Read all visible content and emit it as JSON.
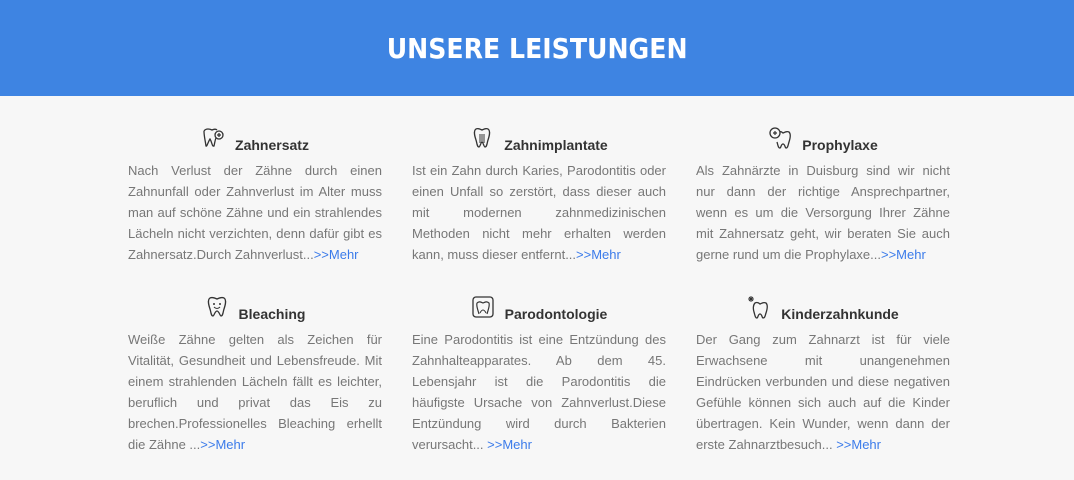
{
  "header": {
    "title": "UNSERE LEISTUNGEN"
  },
  "services": [
    {
      "icon": "tooth-plus-icon",
      "title": "Zahnersatz",
      "lines": [
        "Nach Verlust der Zähne durch einen",
        "Zahnunfall oder Zahnverlust im Alter muss",
        "man auf schöne Zähne und ein strahlendes",
        "Lächeln nicht verzichten, denn dafür gibt es",
        "Zahnersatz.Durch Zahnverlust..."
      ],
      "more": ">>Mehr"
    },
    {
      "icon": "tooth-implant-icon",
      "title": "Zahnimplantate",
      "lines": [
        "Ist ein Zahn durch Karies, Parodontitis oder",
        "einen Unfall so zerstört, dass dieser auch",
        "mit modernen zahnmedizinischen",
        "Methoden nicht mehr erhalten werden",
        "kann, muss dieser entfernt..."
      ],
      "more": ">>Mehr"
    },
    {
      "icon": "tooth-search-icon",
      "title": "Prophylaxe",
      "lines": [
        "Als Zahnärzte in Duisburg sind wir nicht",
        "nur dann der richtige Ansprechpartner,",
        "wenn es um die Versorgung Ihrer Zähne",
        "mit Zahnersatz geht, wir beraten Sie auch",
        "gerne rund um die Prophylaxe..."
      ],
      "more": ">>Mehr"
    },
    {
      "icon": "tooth-smile-icon",
      "title": "Bleaching",
      "lines": [
        "Weiße Zähne gelten als Zeichen für",
        "Vitalität, Gesundheit und Lebensfreude. Mit",
        "einem strahlenden Lächeln fällt es leichter,",
        "beruflich und privat das Eis zu",
        "brechen.Professionelles Bleaching erhellt",
        "die Zähne ..."
      ],
      "more": ">>Mehr"
    },
    {
      "icon": "tooth-gum-icon",
      "title": "Parodontologie",
      "lines": [
        "Eine Parodontitis ist eine Entzündung des",
        "Zahnhalteapparates. Ab dem 45.",
        "Lebensjahr ist die Parodontitis die",
        "häufigste Ursache von Zahnverlust.Diese",
        "Entzündung wird durch Bakterien",
        "verursacht... "
      ],
      "more": ">>Mehr"
    },
    {
      "icon": "tooth-sparkle-icon",
      "title": "Kinderzahnkunde",
      "lines": [
        "Der Gang zum Zahnarzt ist für viele",
        "Erwachsene mit unangenehmen",
        "Eindrücken verbunden und diese negativen",
        "Gefühle können sich auch auf die Kinder",
        "übertragen. Kein Wunder, wenn dann der",
        "erste Zahnarztbesuch... "
      ],
      "more": ">>Mehr"
    }
  ]
}
